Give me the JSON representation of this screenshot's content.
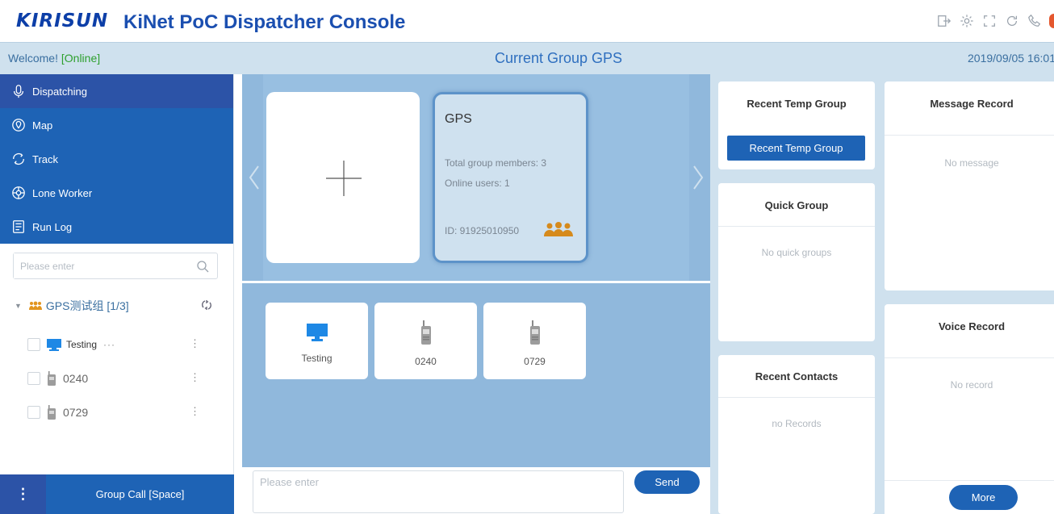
{
  "header": {
    "logo_text": "KIRISUN",
    "app_title": "KiNet PoC Dispatcher Console",
    "icons": [
      "logout-icon",
      "settings-icon",
      "fullscreen-icon",
      "refresh-icon",
      "phone-icon"
    ]
  },
  "statusbar": {
    "welcome": "Welcome!",
    "online": "[Online]",
    "current_group": "Current Group GPS",
    "datetime": "2019/09/05 16:01"
  },
  "sidebar": {
    "menu": [
      {
        "label": "Dispatching",
        "icon": "microphone-icon",
        "active": true
      },
      {
        "label": "Map",
        "icon": "map-pin-icon",
        "active": false
      },
      {
        "label": "Track",
        "icon": "track-icon",
        "active": false
      },
      {
        "label": "Lone Worker",
        "icon": "lone-worker-icon",
        "active": false
      },
      {
        "label": "Run Log",
        "icon": "log-icon",
        "active": false
      }
    ],
    "search_placeholder": "Please enter",
    "group": {
      "name": "GPS测试组 [1/3]"
    },
    "members": [
      {
        "name": "Testing",
        "suffix": "···",
        "type": "dispatcher"
      },
      {
        "name": "0240",
        "type": "radio"
      },
      {
        "name": "0729",
        "type": "radio"
      }
    ],
    "more_label": "⋮",
    "group_call_label": "Group Call [Space]"
  },
  "center": {
    "gps_card": {
      "title": "GPS",
      "total_members": "Total group members: 3",
      "online_users": "Online users: 1",
      "id": "ID: 91925010950"
    },
    "member_cards": [
      {
        "label": "Testing",
        "type": "dispatcher"
      },
      {
        "label": "0240",
        "type": "radio"
      },
      {
        "label": "0729",
        "type": "radio"
      }
    ],
    "message_placeholder": "Please enter",
    "send_label": "Send"
  },
  "right": {
    "recent_temp_group": {
      "title": "Recent Temp Group",
      "button": "Recent Temp Group"
    },
    "quick_group": {
      "title": "Quick Group",
      "empty": "No quick groups"
    },
    "recent_contacts": {
      "title": "Recent Contacts",
      "empty": "no Records"
    },
    "message_record": {
      "title": "Message Record",
      "empty": "No message"
    },
    "voice_record": {
      "title": "Voice Record",
      "empty": "No record",
      "more": "More"
    }
  },
  "colors": {
    "brand_blue": "#1e63b5",
    "menu_active": "#2c53a7",
    "panel_bg": "#90b8dc",
    "online_green": "#2ea02e"
  }
}
